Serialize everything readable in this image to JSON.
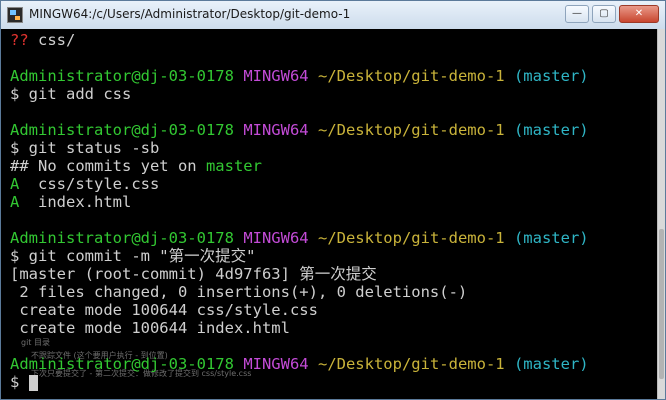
{
  "window": {
    "title": "MINGW64:/c/Users/Administrator/Desktop/git-demo-1",
    "controls": {
      "minimize": "—",
      "maximize": "▢",
      "close": "✕"
    }
  },
  "terminal": {
    "status_1": {
      "marker": "??",
      "path": "css/"
    },
    "prompt": {
      "user": "Administrator@dj-03-0178",
      "env": "MINGW64",
      "path": "~/Desktop/git-demo-1",
      "branch": "(master)",
      "dollar": "$"
    },
    "cmd_add": "$ git add css",
    "cmd_status": "$ git status -sb",
    "status_branch": {
      "prefix": "## No commits yet on ",
      "branch": "master"
    },
    "status_files": [
      {
        "flag": "A",
        "file": "  css/style.css"
      },
      {
        "flag": "A",
        "file": "  index.html"
      }
    ],
    "cmd_commit": "$ git commit -m \"第一次提交\"",
    "commit_output": [
      "[master (root-commit) 4d97f63] 第一次提交",
      " 2 files changed, 0 insertions(+), 0 deletions(-)",
      " create mode 100644 css/style.css",
      " create mode 100644 index.html"
    ],
    "final_prompt": "$",
    "overlay_text": [
      "git 目录",
      "不跟踪文件   (这个要用户执行 - 到位置)",
      "下次只要提交了 - 第二次提交：做修改了提交到 css/style.css"
    ]
  }
}
